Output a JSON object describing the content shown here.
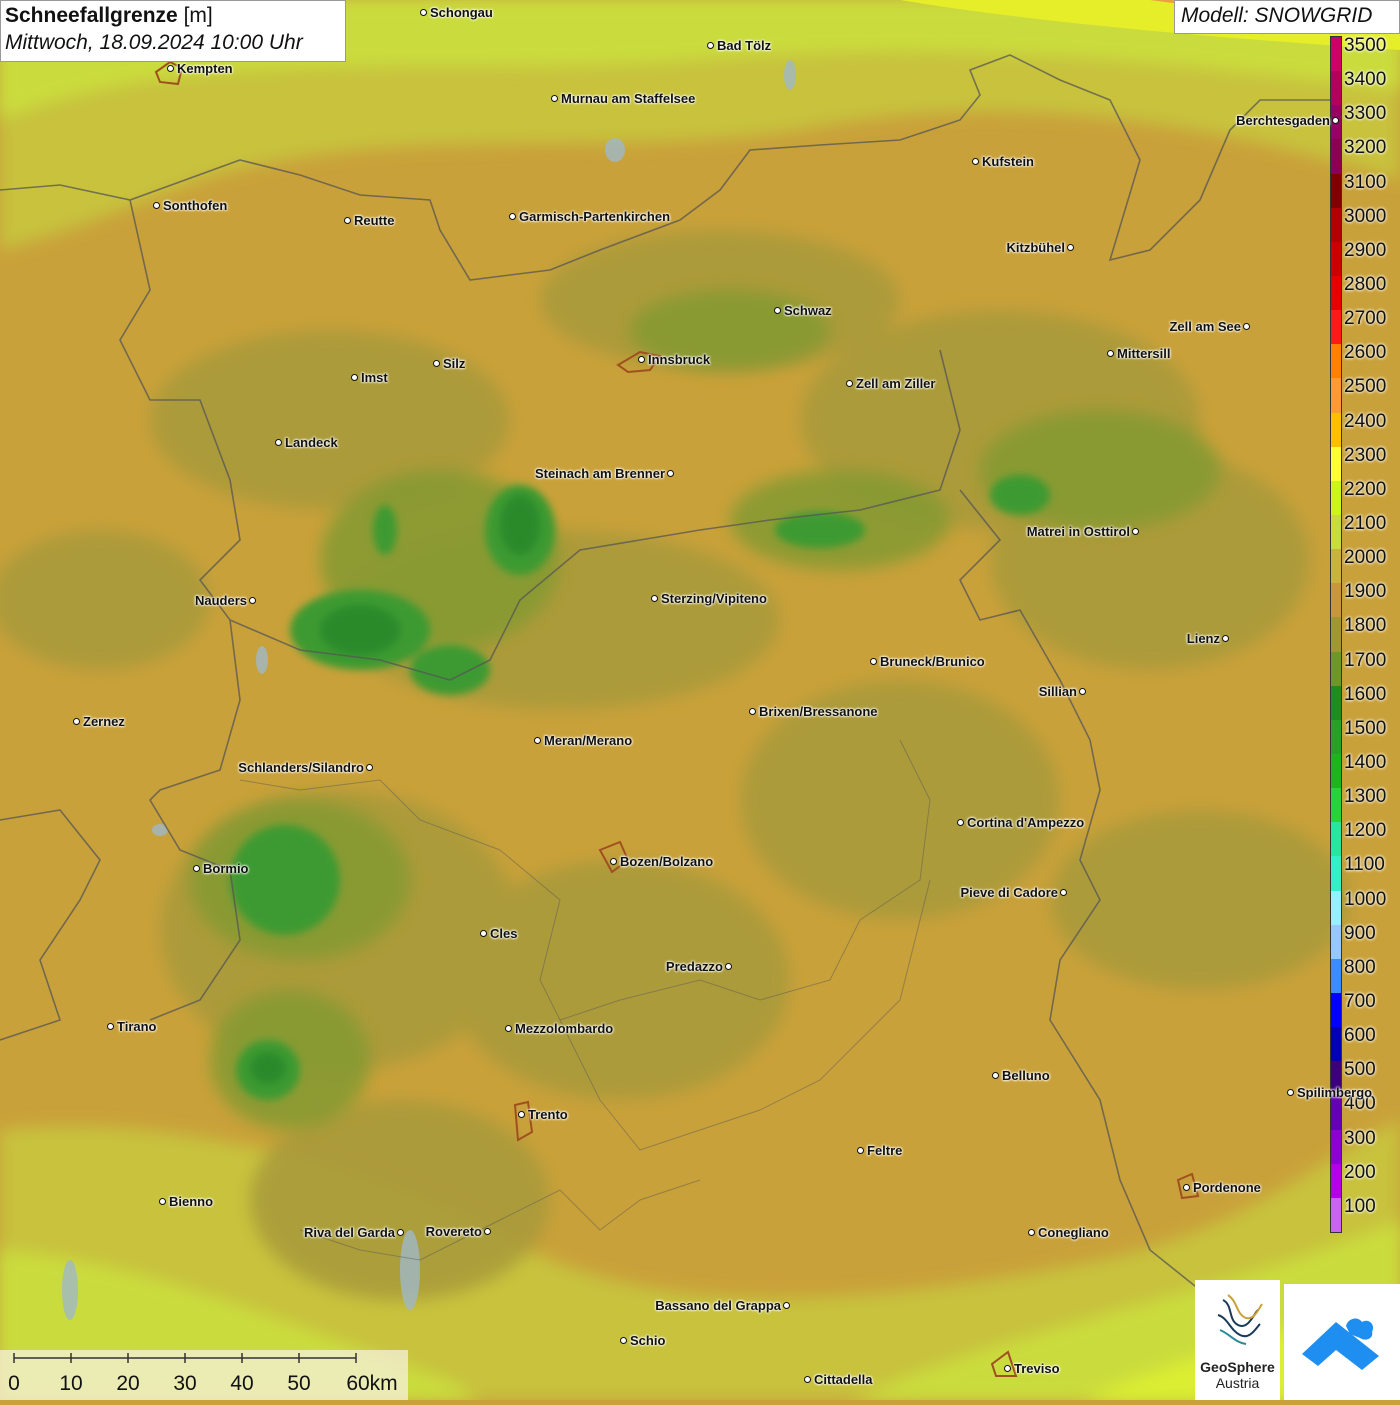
{
  "title": {
    "variable": "Schneefallgrenze",
    "unit": "[m]",
    "datetime": "Mittwoch, 18.09.2024 10:00 Uhr"
  },
  "model": "Modell: SNOWGRID",
  "legend": {
    "values": [
      "3500",
      "3400",
      "3300",
      "3200",
      "3100",
      "3000",
      "2900",
      "2800",
      "2700",
      "2600",
      "2500",
      "2400",
      "2300",
      "2200",
      "2100",
      "2000",
      "1900",
      "1800",
      "1700",
      "1600",
      "1500",
      "1400",
      "1300",
      "1200",
      "1100",
      "1000",
      "900",
      "800",
      "700",
      "600",
      "500",
      "400",
      "300",
      "200",
      "100"
    ],
    "colors": [
      "#cc0066",
      "#b3005c",
      "#990066",
      "#8a0052",
      "#800000",
      "#b30000",
      "#cc0000",
      "#e60000",
      "#ff1a1a",
      "#ff8000",
      "#ff9933",
      "#ffbf00",
      "#ffff33",
      "#ccf51a",
      "#c8dc3c",
      "#c8b43c",
      "#c8963c",
      "#a09632",
      "#6e9628",
      "#1e8c1e",
      "#28a028",
      "#1eb41e",
      "#28d23c",
      "#28e6a0",
      "#32f0c8",
      "#96f0ff",
      "#96c8ff",
      "#3c8cff",
      "#0000ff",
      "#0000b4",
      "#3c0078",
      "#6400b4",
      "#8c00d2",
      "#b400e6",
      "#c864f0"
    ]
  },
  "cities": [
    {
      "name": "Schongau"
    },
    {
      "name": "Kempten"
    },
    {
      "name": "Bad Tölz"
    },
    {
      "name": "Murnau am Staffelsee"
    },
    {
      "name": "Berchtesgaden"
    },
    {
      "name": "Kufstein"
    },
    {
      "name": "Sonthofen"
    },
    {
      "name": "Reutte"
    },
    {
      "name": "Garmisch-Partenkirchen"
    },
    {
      "name": "Kitzbühel"
    },
    {
      "name": "Schwaz"
    },
    {
      "name": "Zell am See"
    },
    {
      "name": "Innsbruck"
    },
    {
      "name": "Mittersill"
    },
    {
      "name": "Imst"
    },
    {
      "name": "Silz"
    },
    {
      "name": "Zell am Ziller"
    },
    {
      "name": "Landeck"
    },
    {
      "name": "Steinach am Brenner"
    },
    {
      "name": "Matrei in Osttirol"
    },
    {
      "name": "Nauders"
    },
    {
      "name": "Sterzing/Vipiteno"
    },
    {
      "name": "Lienz"
    },
    {
      "name": "Bruneck/Brunico"
    },
    {
      "name": "Sillian"
    },
    {
      "name": "Zernez"
    },
    {
      "name": "Brixen/Bressanone"
    },
    {
      "name": "Meran/Merano"
    },
    {
      "name": "Schlanders/Silandro"
    },
    {
      "name": "Cortina d'Ampezzo"
    },
    {
      "name": "Bormio"
    },
    {
      "name": "Bozen/Bolzano"
    },
    {
      "name": "Pieve di Cadore"
    },
    {
      "name": "Cles"
    },
    {
      "name": "Predazzo"
    },
    {
      "name": "Tirano"
    },
    {
      "name": "Mezzolombardo"
    },
    {
      "name": "Belluno"
    },
    {
      "name": "Spilimbergo"
    },
    {
      "name": "Trento"
    },
    {
      "name": "Feltre"
    },
    {
      "name": "Pordenone"
    },
    {
      "name": "Bienno"
    },
    {
      "name": "Riva del Garda"
    },
    {
      "name": "Rovereto"
    },
    {
      "name": "Conegliano"
    },
    {
      "name": "Bassano del Grappa"
    },
    {
      "name": "Schio"
    },
    {
      "name": "Treviso"
    },
    {
      "name": "Cittadella"
    }
  ],
  "scale_bar": {
    "labels": [
      "0",
      "10",
      "20",
      "30",
      "40",
      "50",
      "60km"
    ]
  },
  "logos": {
    "geosphere_name": "GeoSphere",
    "geosphere_country": "Austria"
  }
}
